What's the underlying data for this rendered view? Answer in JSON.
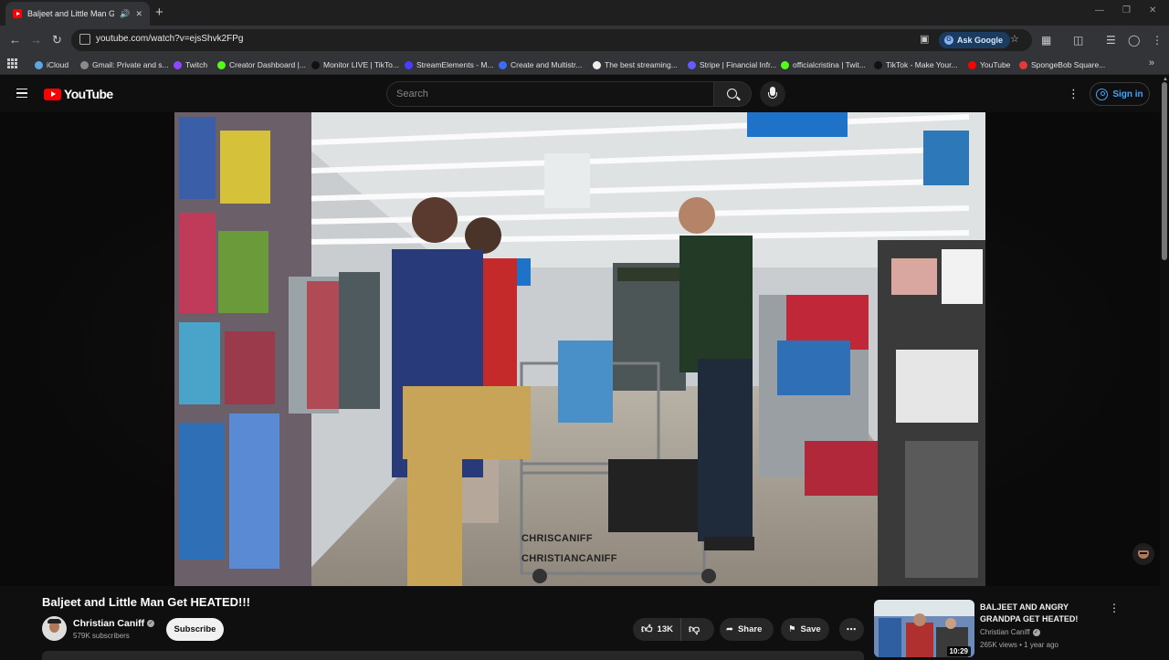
{
  "browser": {
    "tab": {
      "title": "Baljeet and Little Man Get HEATED!!!"
    },
    "url": "youtube.com/watch?v=ejsShvk2FPg",
    "ask_google_label": "Ask Google",
    "bookmarks": [
      {
        "label": "iCloud",
        "color": "#5aa9e6"
      },
      {
        "label": "Gmail: Private and s...",
        "color": "#8a8a8a"
      },
      {
        "label": "Twitch",
        "color": "#9146ff"
      },
      {
        "label": "Creator Dashboard |...",
        "color": "#53fc18"
      },
      {
        "label": "Monitor LIVE | TikTo...",
        "color": "#111111"
      },
      {
        "label": "StreamElements - M...",
        "color": "#4b3cff"
      },
      {
        "label": "Create and Multistr...",
        "color": "#3a6cf4"
      },
      {
        "label": "The best streaming...",
        "color": "#eeeeee"
      },
      {
        "label": "Stripe | Financial Infr...",
        "color": "#635bff"
      },
      {
        "label": "officialcristina | Twit...",
        "color": "#53fc18"
      },
      {
        "label": "TikTok - Make Your...",
        "color": "#111111"
      },
      {
        "label": "YouTube",
        "color": "#ff0000"
      },
      {
        "label": "SpongeBob Square...",
        "color": "#e53935"
      }
    ]
  },
  "youtube": {
    "logo_text": "YouTube",
    "search_placeholder": "Search",
    "signin_label": "Sign in"
  },
  "video": {
    "watermark_line1": "CHRISCANIFF",
    "watermark_line2": "CHRISTIANCANIFF",
    "title": "Baljeet and Little Man Get HEATED!!!",
    "channel": "Christian Caniff",
    "subscribers": "579K subscribers",
    "subscribe_label": "Subscribe",
    "likes": "13K",
    "share_label": "Share",
    "save_label": "Save"
  },
  "recommended": {
    "title": "BALJEET AND ANGRY GRANDPA GET HEATED!",
    "channel": "Christian Caniff",
    "meta": "265K views • 1 year ago",
    "duration": "10:29"
  },
  "colors": {
    "brand_red": "#ff0000",
    "link_blue": "#3ea6ff",
    "background": "#0f0f0f"
  }
}
